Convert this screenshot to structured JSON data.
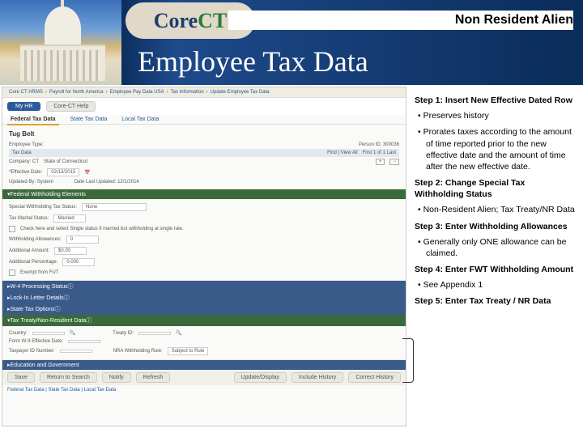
{
  "head": {
    "logo_c": "Core",
    "logo_ct": "CT",
    "nra": "Non Resident Alien",
    "title": "Employee Tax Data"
  },
  "shot": {
    "crumb": [
      "Core CT HRMS",
      "Payroll for North America",
      "Employee Pay Data USA",
      "Tax Information",
      "Update Employee Tax Data"
    ],
    "btn_hr": "My HR",
    "btn_help": "Core-CT Help",
    "tabs": [
      "Federal Tax Data",
      "State Tax Data",
      "Local Tax Data"
    ],
    "emp": "Tug Belt",
    "emptype": "Employee Type:",
    "person": "Person ID: 300036",
    "find": "Find | View All",
    "pager": "First 1 of 1 Last",
    "company": "Company: CT",
    "state": "State of Connecticut",
    "eff": "*Effective Date:",
    "effv": "02/13/2015",
    "upd": "Updated By: System",
    "lupd": "Date Last Updated: 12/1/2014",
    "fwe": "Federal Withholding Elements",
    "specmw": "Special Withholding Tax Status:",
    "specmwv": "None",
    "taxms": "Tax Marital Status:",
    "taxmsv": "Married",
    "chk": "Check here and select Single status if married but withholding at single rate.",
    "wa": "Withholding Allowances:",
    "wav": "0",
    "aa": "Additional Amount:",
    "aav": "$0.00",
    "ap": "Additional Percentage:",
    "apv": "0.000",
    "exempt": "Exempt from FUT",
    "w4": "W-4 Processing Status",
    "lock": "Lock-In Letter Details",
    "sto": "State Tax Options",
    "treaty": "Tax Treaty/Non-Resident Data",
    "country": "Country:",
    "tid": "Treaty ID:",
    "form": "Form W-9 Effective Date:",
    "taxid": "Taxpayer ID Number:",
    "nra": "NRA Withholding Rule:",
    "nrav": "Subject to Rule",
    "edu": "Education and Government",
    "bot": [
      "Save",
      "Return to Search",
      "Notify",
      "Refresh",
      "Update/Display",
      "Include History",
      "Correct History"
    ],
    "botline": "Federal Tax Data | State Tax Data | Local Tax Data"
  },
  "s": {
    "s1": "Step 1: Insert New Effective Dated Row",
    "s1a": "Preserves history",
    "s1b": "Prorates taxes according to the amount of time reported prior to the new effective date and the amount of time after the new effective date.",
    "s2": "Step 2: Change Special Tax Withholding Status",
    "s2a": "Non-Resident Alien; Tax Treaty/NR Data",
    "s3": "Step 3: Enter Withholding Allowances",
    "s3a": "Generally only ONE allowance can be claimed.",
    "s4": "Step 4: Enter FWT Withholding Amount",
    "s4a": "See Appendix 1",
    "s5": "Step 5: Enter Tax Treaty / NR Data"
  }
}
